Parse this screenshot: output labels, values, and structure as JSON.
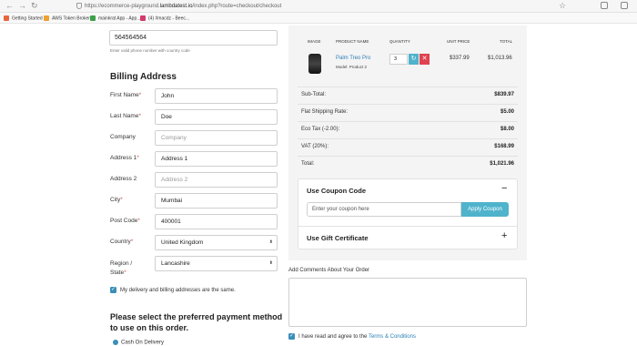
{
  "browser": {
    "back_glyph": "←",
    "forward_glyph": "→",
    "reload_glyph": "↻",
    "url_prefix": "https://ecommerce-playground.",
    "url_host": "lambdatest.io",
    "url_path": "/index.php?route=checkout/checkout",
    "star_glyph": "☆",
    "bookmarks": [
      {
        "label": "Getting Started",
        "color": "#e8663d"
      },
      {
        "label": "AWS Token Broker",
        "color": "#f0a030"
      },
      {
        "label": "mainkrat App - App...",
        "color": "#3da04a"
      },
      {
        "label": "(4) #macdz - Beec...",
        "color": "#d23b6a"
      }
    ]
  },
  "phone": {
    "value": "564564564",
    "hint": "Enter valid phone number with country code"
  },
  "billing": {
    "title": "Billing Address",
    "fields": [
      {
        "label": "First Name",
        "required": true,
        "value": "John",
        "placeholder": false
      },
      {
        "label": "Last Name",
        "required": true,
        "value": "Doe",
        "placeholder": false
      },
      {
        "label": "Company",
        "required": false,
        "value": "Company",
        "placeholder": true
      },
      {
        "label": "Address 1",
        "required": true,
        "value": "Address 1",
        "placeholder": false
      },
      {
        "label": "Address 2",
        "required": false,
        "value": "Address 2",
        "placeholder": true
      },
      {
        "label": "City",
        "required": true,
        "value": "Mumbai",
        "placeholder": false
      },
      {
        "label": "Post Code",
        "required": true,
        "value": "400001",
        "placeholder": false
      },
      {
        "label": "Country",
        "required": true,
        "value": "United Kingdom",
        "placeholder": false
      },
      {
        "label_line1": "Region /",
        "label_line2": "State",
        "required": true,
        "value": "Lancashire",
        "placeholder": false
      }
    ],
    "same_address_label": "My delivery and billing addresses are the same.",
    "select_arrows": "⬍",
    "required_mark": "*"
  },
  "payment": {
    "title": "Please select the preferred payment method to use on this order.",
    "option_cod": "Cash On Delivery"
  },
  "cart": {
    "headers": {
      "image": "IMAGE",
      "product_name": "PRODUCT NAME",
      "quantity": "QUANTITY",
      "unit_price": "UNIT PRICE",
      "total": "TOTAL"
    },
    "item": {
      "name": "Palm Treo Pro",
      "model": "Model: Product 2",
      "quantity": "3",
      "unit_price": "$337.99",
      "total": "$1,013.96",
      "refresh_glyph": "↻",
      "remove_glyph": "✕"
    },
    "summary": [
      {
        "label": "Sub-Total:",
        "value": "$839.97"
      },
      {
        "label": "Flat Shipping Rate:",
        "value": "$5.00"
      },
      {
        "label": "Eco Tax (-2.00):",
        "value": "$8.00"
      },
      {
        "label": "VAT (20%):",
        "value": "$168.99"
      },
      {
        "label": "Total:",
        "value": "$1,021.96"
      }
    ]
  },
  "coupon": {
    "title": "Use Coupon Code",
    "toggle": "−",
    "placeholder": "Enter your coupon here",
    "button": "Apply Coupon"
  },
  "gift": {
    "title": "Use Gift Certificate",
    "toggle": "+"
  },
  "comments": {
    "label": "Add Comments About Your Order"
  },
  "agree": {
    "text": "I have read and agree to the ",
    "link": "Terms & Conditions"
  },
  "checkmark": "✓"
}
